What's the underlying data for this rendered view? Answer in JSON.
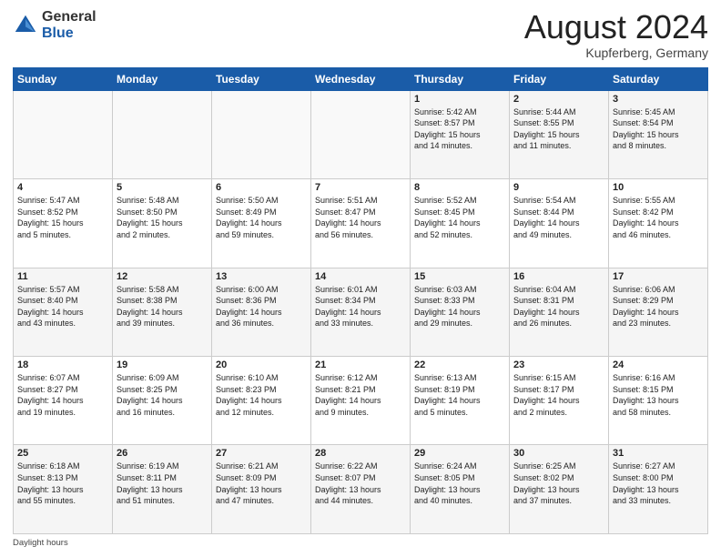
{
  "header": {
    "logo_general": "General",
    "logo_blue": "Blue",
    "month_title": "August 2024",
    "location": "Kupferberg, Germany"
  },
  "footer": {
    "text": "Daylight hours"
  },
  "days_of_week": [
    "Sunday",
    "Monday",
    "Tuesday",
    "Wednesday",
    "Thursday",
    "Friday",
    "Saturday"
  ],
  "weeks": [
    [
      {
        "day": "",
        "info": ""
      },
      {
        "day": "",
        "info": ""
      },
      {
        "day": "",
        "info": ""
      },
      {
        "day": "",
        "info": ""
      },
      {
        "day": "1",
        "info": "Sunrise: 5:42 AM\nSunset: 8:57 PM\nDaylight: 15 hours\nand 14 minutes."
      },
      {
        "day": "2",
        "info": "Sunrise: 5:44 AM\nSunset: 8:55 PM\nDaylight: 15 hours\nand 11 minutes."
      },
      {
        "day": "3",
        "info": "Sunrise: 5:45 AM\nSunset: 8:54 PM\nDaylight: 15 hours\nand 8 minutes."
      }
    ],
    [
      {
        "day": "4",
        "info": "Sunrise: 5:47 AM\nSunset: 8:52 PM\nDaylight: 15 hours\nand 5 minutes."
      },
      {
        "day": "5",
        "info": "Sunrise: 5:48 AM\nSunset: 8:50 PM\nDaylight: 15 hours\nand 2 minutes."
      },
      {
        "day": "6",
        "info": "Sunrise: 5:50 AM\nSunset: 8:49 PM\nDaylight: 14 hours\nand 59 minutes."
      },
      {
        "day": "7",
        "info": "Sunrise: 5:51 AM\nSunset: 8:47 PM\nDaylight: 14 hours\nand 56 minutes."
      },
      {
        "day": "8",
        "info": "Sunrise: 5:52 AM\nSunset: 8:45 PM\nDaylight: 14 hours\nand 52 minutes."
      },
      {
        "day": "9",
        "info": "Sunrise: 5:54 AM\nSunset: 8:44 PM\nDaylight: 14 hours\nand 49 minutes."
      },
      {
        "day": "10",
        "info": "Sunrise: 5:55 AM\nSunset: 8:42 PM\nDaylight: 14 hours\nand 46 minutes."
      }
    ],
    [
      {
        "day": "11",
        "info": "Sunrise: 5:57 AM\nSunset: 8:40 PM\nDaylight: 14 hours\nand 43 minutes."
      },
      {
        "day": "12",
        "info": "Sunrise: 5:58 AM\nSunset: 8:38 PM\nDaylight: 14 hours\nand 39 minutes."
      },
      {
        "day": "13",
        "info": "Sunrise: 6:00 AM\nSunset: 8:36 PM\nDaylight: 14 hours\nand 36 minutes."
      },
      {
        "day": "14",
        "info": "Sunrise: 6:01 AM\nSunset: 8:34 PM\nDaylight: 14 hours\nand 33 minutes."
      },
      {
        "day": "15",
        "info": "Sunrise: 6:03 AM\nSunset: 8:33 PM\nDaylight: 14 hours\nand 29 minutes."
      },
      {
        "day": "16",
        "info": "Sunrise: 6:04 AM\nSunset: 8:31 PM\nDaylight: 14 hours\nand 26 minutes."
      },
      {
        "day": "17",
        "info": "Sunrise: 6:06 AM\nSunset: 8:29 PM\nDaylight: 14 hours\nand 23 minutes."
      }
    ],
    [
      {
        "day": "18",
        "info": "Sunrise: 6:07 AM\nSunset: 8:27 PM\nDaylight: 14 hours\nand 19 minutes."
      },
      {
        "day": "19",
        "info": "Sunrise: 6:09 AM\nSunset: 8:25 PM\nDaylight: 14 hours\nand 16 minutes."
      },
      {
        "day": "20",
        "info": "Sunrise: 6:10 AM\nSunset: 8:23 PM\nDaylight: 14 hours\nand 12 minutes."
      },
      {
        "day": "21",
        "info": "Sunrise: 6:12 AM\nSunset: 8:21 PM\nDaylight: 14 hours\nand 9 minutes."
      },
      {
        "day": "22",
        "info": "Sunrise: 6:13 AM\nSunset: 8:19 PM\nDaylight: 14 hours\nand 5 minutes."
      },
      {
        "day": "23",
        "info": "Sunrise: 6:15 AM\nSunset: 8:17 PM\nDaylight: 14 hours\nand 2 minutes."
      },
      {
        "day": "24",
        "info": "Sunrise: 6:16 AM\nSunset: 8:15 PM\nDaylight: 13 hours\nand 58 minutes."
      }
    ],
    [
      {
        "day": "25",
        "info": "Sunrise: 6:18 AM\nSunset: 8:13 PM\nDaylight: 13 hours\nand 55 minutes."
      },
      {
        "day": "26",
        "info": "Sunrise: 6:19 AM\nSunset: 8:11 PM\nDaylight: 13 hours\nand 51 minutes."
      },
      {
        "day": "27",
        "info": "Sunrise: 6:21 AM\nSunset: 8:09 PM\nDaylight: 13 hours\nand 47 minutes."
      },
      {
        "day": "28",
        "info": "Sunrise: 6:22 AM\nSunset: 8:07 PM\nDaylight: 13 hours\nand 44 minutes."
      },
      {
        "day": "29",
        "info": "Sunrise: 6:24 AM\nSunset: 8:05 PM\nDaylight: 13 hours\nand 40 minutes."
      },
      {
        "day": "30",
        "info": "Sunrise: 6:25 AM\nSunset: 8:02 PM\nDaylight: 13 hours\nand 37 minutes."
      },
      {
        "day": "31",
        "info": "Sunrise: 6:27 AM\nSunset: 8:00 PM\nDaylight: 13 hours\nand 33 minutes."
      }
    ]
  ]
}
